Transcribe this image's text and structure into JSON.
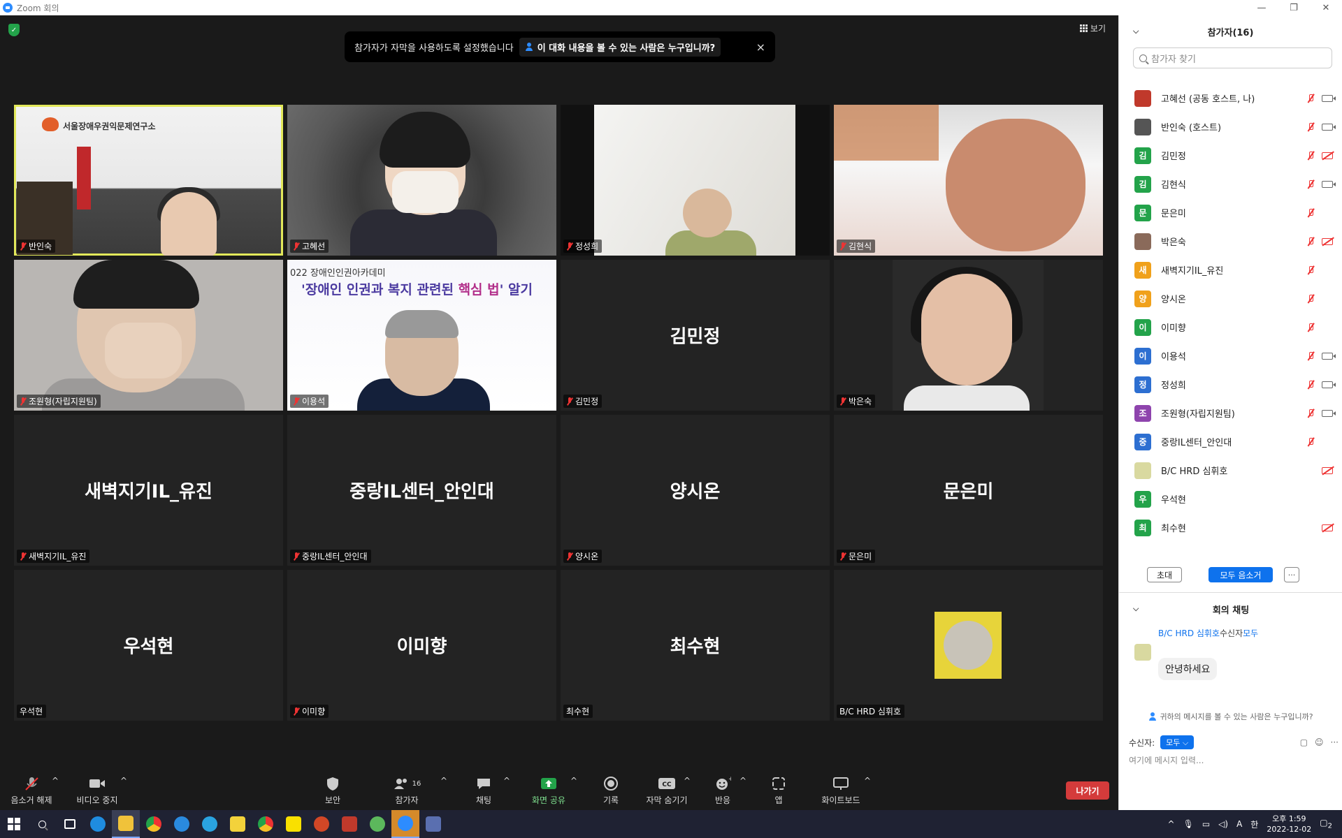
{
  "window": {
    "title": "Zoom 회의",
    "controls": [
      "—",
      "❐",
      "✕"
    ]
  },
  "banner": {
    "text": "참가자가 자막을 사용하도록 설정했습니다",
    "who_link": "이 대화 내용을 볼 수 있는 사람은 누구입니까?",
    "close": "×"
  },
  "view_button": "보기",
  "tiles": [
    {
      "name": "반인숙",
      "video": true,
      "muted": true
    },
    {
      "name": "고혜선",
      "video": true,
      "muted": true
    },
    {
      "name": "정성희",
      "video": true,
      "muted": true
    },
    {
      "name": "김현식",
      "video": true,
      "muted": true
    },
    {
      "name": "조원형(자립지원팀)",
      "video": true,
      "muted": true
    },
    {
      "name": "이용석",
      "video": true,
      "muted": true
    },
    {
      "name": "김민정",
      "video": false,
      "muted": true
    },
    {
      "name": "박은숙",
      "video": true,
      "muted": true
    },
    {
      "name": "새벽지기IL_유진",
      "video": false,
      "muted": true
    },
    {
      "name": "중랑IL센터_안인대",
      "video": false,
      "muted": true
    },
    {
      "name": "양시온",
      "video": false,
      "muted": true
    },
    {
      "name": "문은미",
      "video": false,
      "muted": true
    },
    {
      "name": "우석현",
      "video": false,
      "muted": false
    },
    {
      "name": "이미향",
      "video": false,
      "muted": true
    },
    {
      "name": "최수현",
      "video": false,
      "muted": false
    },
    {
      "name": "B/C HRD 심휘호",
      "video": false,
      "muted": false
    }
  ],
  "office_sign": "서울장애우권익문제연구소",
  "lecture": {
    "subtitle": "022 장애인인권아카데미",
    "title_a": "'장애인 인권과 복지 관련된 ",
    "title_b": "핵심 법",
    "title_c": "' 알기"
  },
  "toolbar": {
    "unmute": "음소거 해제",
    "stop_video": "비디오 중지",
    "security": "보안",
    "participants": "참가자",
    "participants_count": "16",
    "chat": "채팅",
    "share": "화면 공유",
    "record": "기록",
    "captions": "자막 숨기기",
    "reactions": "반응",
    "apps": "앱",
    "whiteboard": "화이트보드",
    "leave": "나가기"
  },
  "panel": {
    "title": "참가자(16)",
    "search_placeholder": "참가자 찾기",
    "participants": [
      {
        "name": "고혜선 (공동 호스트, 나)",
        "initial": "",
        "color": "#c0392b",
        "mic": "off",
        "cam": "on"
      },
      {
        "name": "반인숙 (호스트)",
        "initial": "",
        "color": "#555555",
        "mic": "off",
        "cam": "on"
      },
      {
        "name": "김민정",
        "initial": "김",
        "color": "#23a34a",
        "mic": "off",
        "cam": "off"
      },
      {
        "name": "김현식",
        "initial": "김",
        "color": "#23a34a",
        "mic": "off",
        "cam": "on"
      },
      {
        "name": "문은미",
        "initial": "문",
        "color": "#23a34a",
        "mic": "off",
        "cam": "none"
      },
      {
        "name": "박은숙",
        "initial": "",
        "color": "#8a6a5a",
        "mic": "off",
        "cam": "off"
      },
      {
        "name": "새벽지기IL_유진",
        "initial": "새",
        "color": "#f0a11b",
        "mic": "off",
        "cam": "none"
      },
      {
        "name": "양시온",
        "initial": "양",
        "color": "#f0a11b",
        "mic": "off",
        "cam": "none"
      },
      {
        "name": "이미향",
        "initial": "이",
        "color": "#23a34a",
        "mic": "off",
        "cam": "none"
      },
      {
        "name": "이용석",
        "initial": "이",
        "color": "#2d6fd1",
        "mic": "off",
        "cam": "on"
      },
      {
        "name": "정성희",
        "initial": "정",
        "color": "#2d6fd1",
        "mic": "off",
        "cam": "on"
      },
      {
        "name": "조원형(자립지원팀)",
        "initial": "조",
        "color": "#8e44ad",
        "mic": "off",
        "cam": "on"
      },
      {
        "name": "중랑IL센터_안인대",
        "initial": "중",
        "color": "#2d6fd1",
        "mic": "off",
        "cam": "none"
      },
      {
        "name": "B/C HRD 심휘호",
        "initial": "",
        "color": "#d9d9a0",
        "mic": "none",
        "cam": "off"
      },
      {
        "name": "우석현",
        "initial": "우",
        "color": "#23a34a",
        "mic": "none",
        "cam": "none"
      },
      {
        "name": "최수현",
        "initial": "최",
        "color": "#23a34a",
        "mic": "none",
        "cam": "off"
      }
    ],
    "invite": "초대",
    "mute_all": "모두 음소거",
    "more": "···"
  },
  "chat": {
    "title": "회의 채팅",
    "sender": "B/C HRD 심휘호",
    "to_label": "수신자",
    "to_value": "모두",
    "message": "안녕하세요",
    "who_can_see": "귀하의 메시지를 볼 수 있는 사람은 누구입니까?",
    "recipient_label": "수신자:",
    "recipient_value": "모두",
    "input_placeholder": "여기에 메시지 입력..."
  },
  "taskbar": {
    "time": "오후 1:59",
    "date": "2022-12-02",
    "ime": "A",
    "ime2": "한",
    "notif": "2"
  }
}
